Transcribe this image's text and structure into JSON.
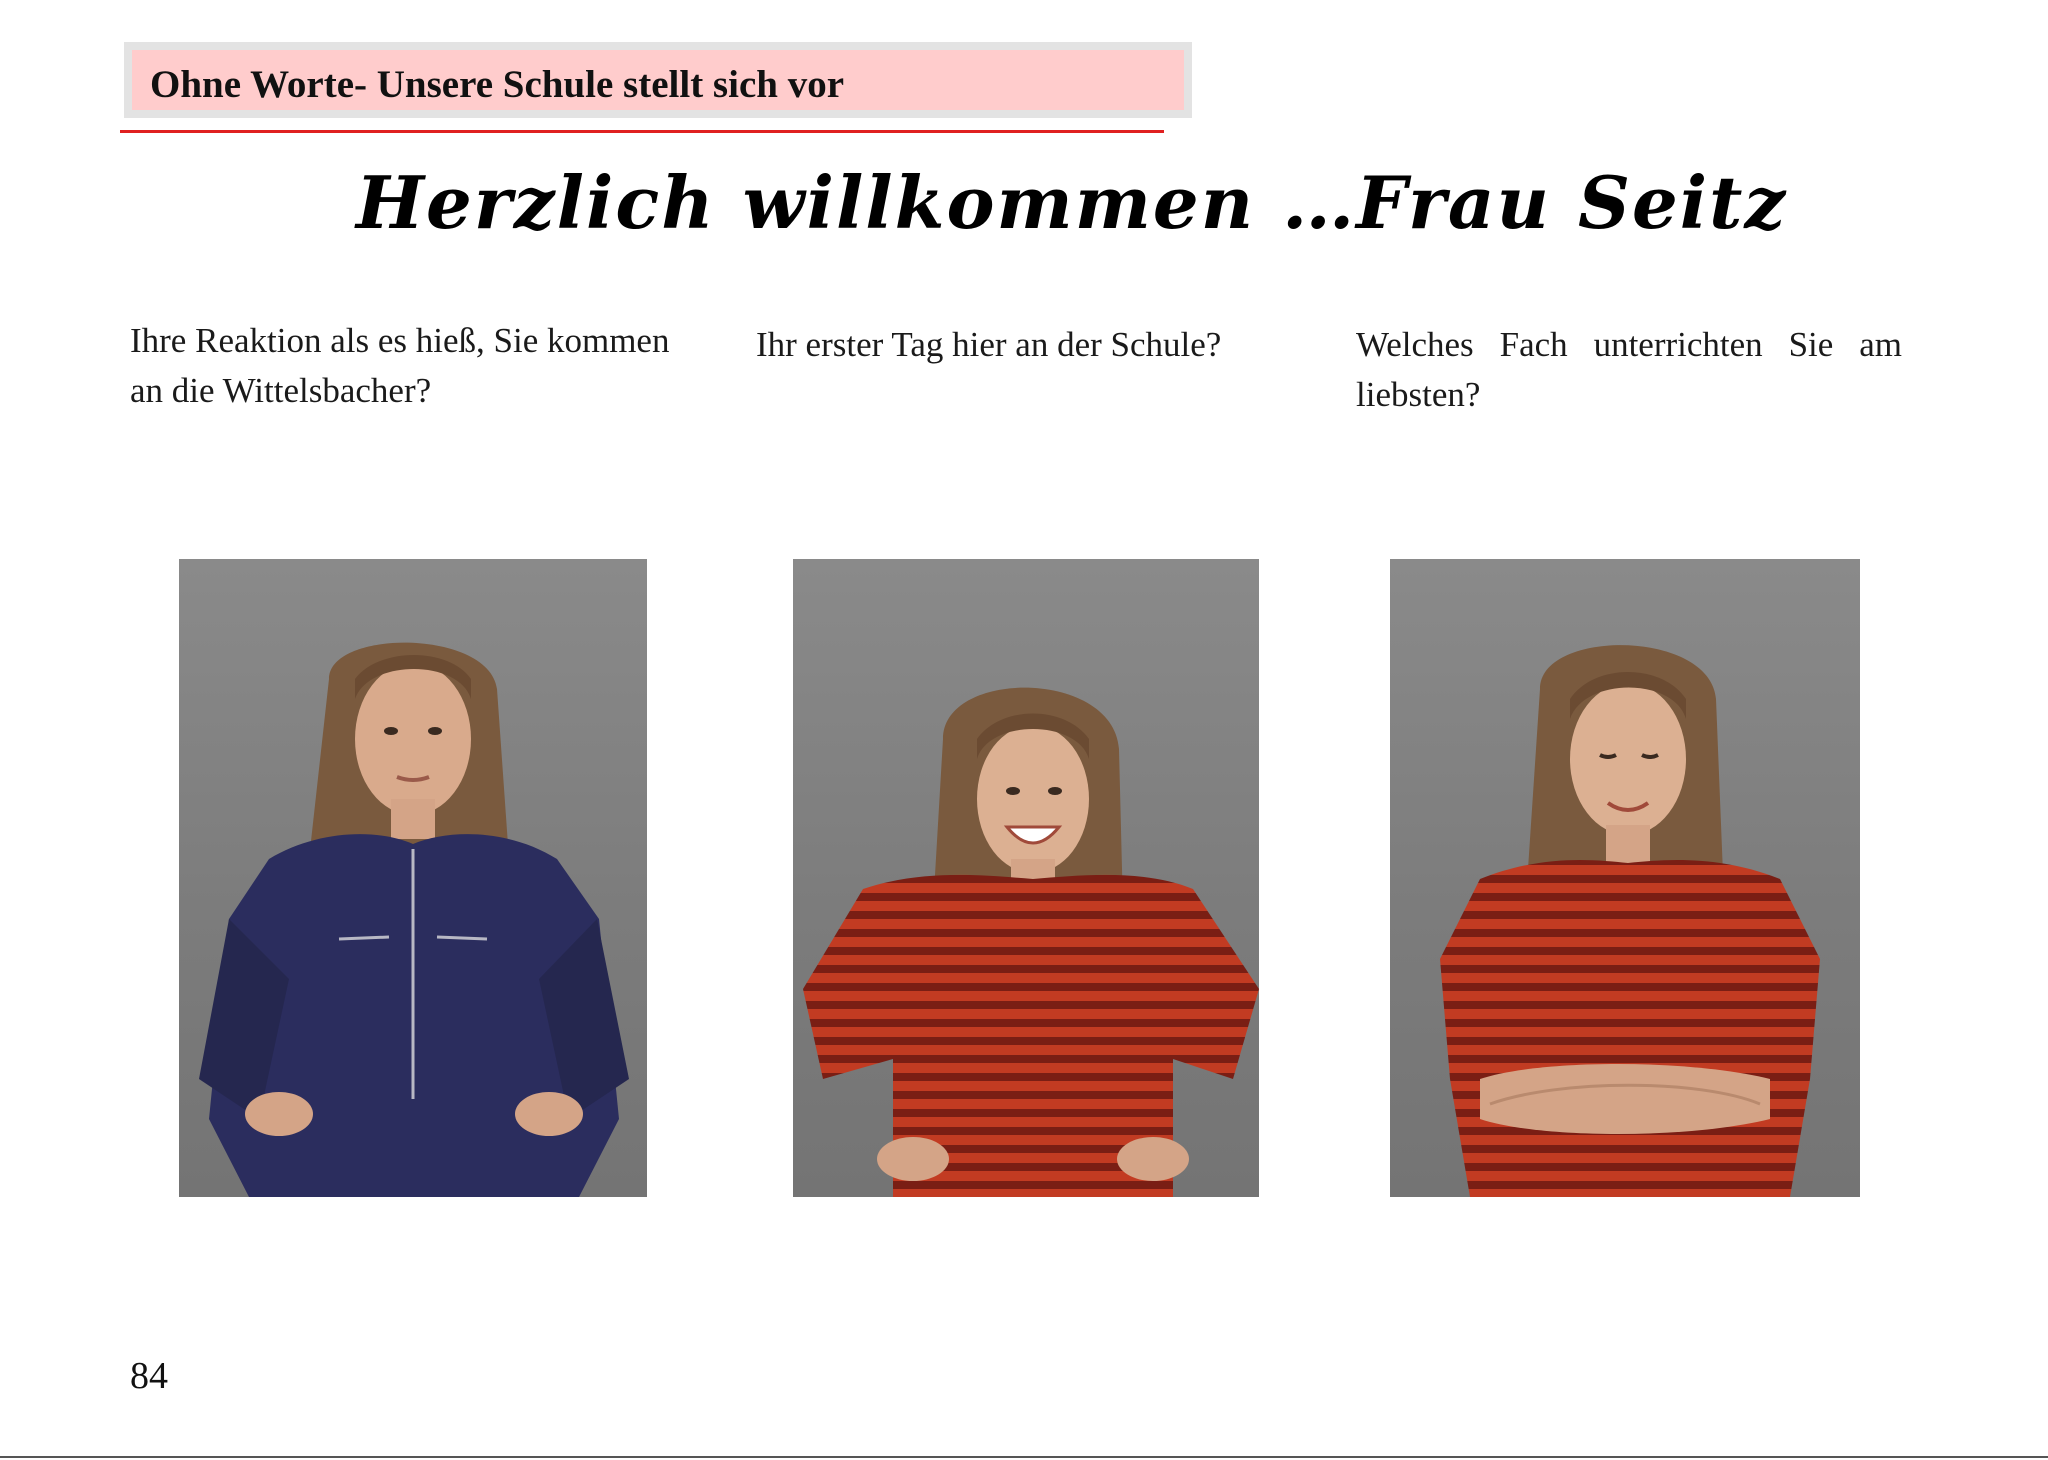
{
  "header": {
    "title": "Ohne Worte- Unsere Schule stellt sich vor"
  },
  "welcome": "Herzlich willkommen …Frau  Seitz",
  "questions": [
    {
      "text": "Ihre Reaktion als es hieß, Sie kommen an die Wittelsbacher?"
    },
    {
      "text": "Ihr erster Tag hier an der Schule?"
    },
    {
      "text": "Welches Fach unterrichten Sie am liebsten?"
    }
  ],
  "photos": [
    {
      "description": "blue-jumpsuit-hands-on-hips"
    },
    {
      "description": "red-striped-shirt-big-smile"
    },
    {
      "description": "red-striped-shirt-arms-crossed-looking-down"
    }
  ],
  "colors": {
    "header_fill": "#ffcccc",
    "header_border": "#e3e3e3",
    "rule": "#e02020",
    "photo_background": "#808080",
    "blue_outfit": "#2b2d5e",
    "red_stripe": "#c23b22",
    "dark_stripe": "#7a1e14"
  },
  "page_number": "84"
}
